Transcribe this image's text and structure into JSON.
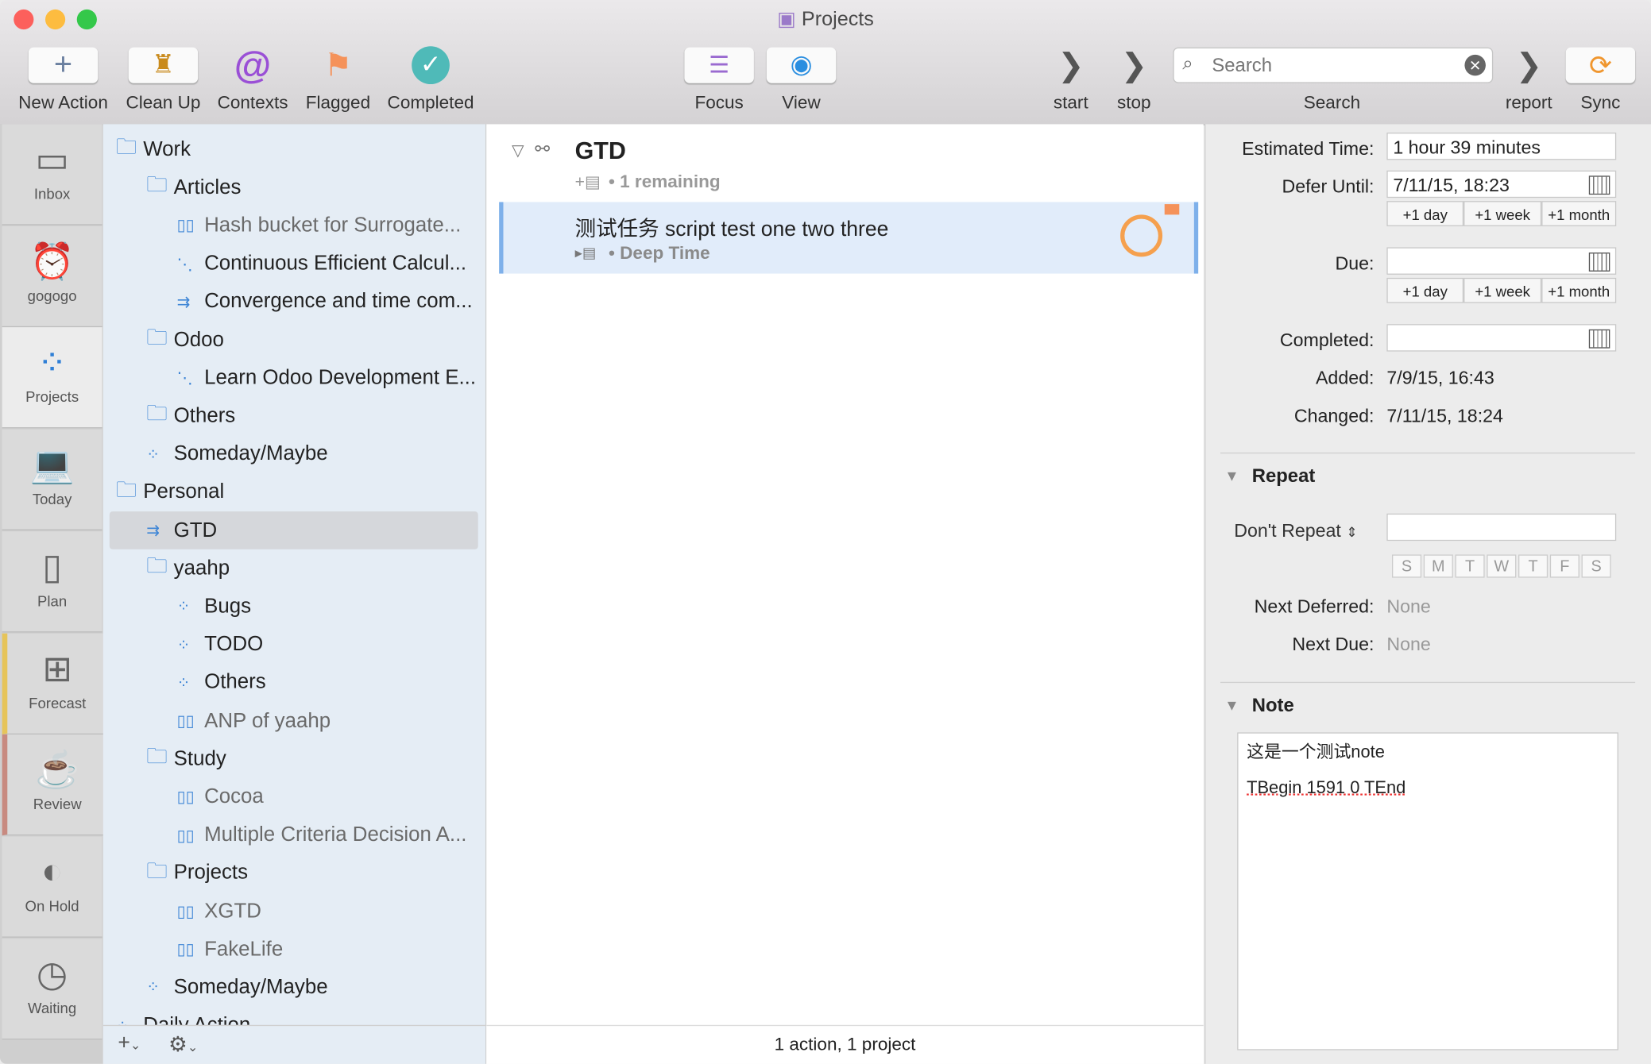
{
  "window": {
    "title": "Projects"
  },
  "toolbar": {
    "new_action": "New Action",
    "clean_up": "Clean Up",
    "contexts": "Contexts",
    "flagged": "Flagged",
    "completed": "Completed",
    "focus": "Focus",
    "view": "View",
    "start": "start",
    "stop": "stop",
    "search_label": "Search",
    "search_placeholder": "Search",
    "report": "report",
    "sync": "Sync"
  },
  "rail": [
    "Inbox",
    "gogogo",
    "Projects",
    "Today",
    "Plan",
    "Forecast",
    "Review",
    "On Hold",
    "Waiting"
  ],
  "sidebar": [
    {
      "label": "Work",
      "type": "folder"
    },
    {
      "label": "Articles",
      "type": "folder"
    },
    {
      "label": "Hash bucket for Surrogate...",
      "type": "single"
    },
    {
      "label": "Continuous Efficient Calcul...",
      "type": "sequential"
    },
    {
      "label": "Convergence and time com...",
      "type": "parallel"
    },
    {
      "label": "Odoo",
      "type": "folder"
    },
    {
      "label": "Learn Odoo Development E...",
      "type": "sequential"
    },
    {
      "label": "Others",
      "type": "folder"
    },
    {
      "label": "Someday/Maybe",
      "type": "someday"
    },
    {
      "label": "Personal",
      "type": "folder"
    },
    {
      "label": "GTD",
      "type": "parallel"
    },
    {
      "label": "yaahp",
      "type": "folder"
    },
    {
      "label": "Bugs",
      "type": "someday"
    },
    {
      "label": "TODO",
      "type": "someday"
    },
    {
      "label": "Others",
      "type": "someday"
    },
    {
      "label": "ANP of yaahp",
      "type": "single"
    },
    {
      "label": "Study",
      "type": "folder"
    },
    {
      "label": "Cocoa",
      "type": "single"
    },
    {
      "label": "Multiple Criteria Decision A...",
      "type": "single"
    },
    {
      "label": "Projects",
      "type": "folder"
    },
    {
      "label": "XGTD",
      "type": "single"
    },
    {
      "label": "FakeLife",
      "type": "single"
    },
    {
      "label": "Someday/Maybe",
      "type": "someday"
    },
    {
      "label": "Daily Action",
      "type": "someday"
    }
  ],
  "main": {
    "project": "GTD",
    "remaining": "• 1 remaining",
    "task": "测试任务 script test one two three",
    "task_context": "• Deep Time",
    "status": "1 action, 1 project"
  },
  "inspector": {
    "estimated_label": "Estimated Time:",
    "estimated": "1 hour 39 minutes",
    "defer_label": "Defer Until:",
    "defer": "7/11/15, 18:23",
    "due_label": "Due:",
    "due": "",
    "completed_label": "Completed:",
    "completed": "",
    "plus_day": "+1 day",
    "plus_week": "+1 week",
    "plus_month": "+1 month",
    "added_label": "Added:",
    "added": "7/9/15, 16:43",
    "changed_label": "Changed:",
    "changed": "7/11/15, 18:24",
    "repeat_header": "Repeat",
    "repeat_mode": "Don't Repeat",
    "days": [
      "S",
      "M",
      "T",
      "W",
      "T",
      "F",
      "S"
    ],
    "next_deferred_label": "Next Deferred:",
    "next_deferred": "None",
    "next_due_label": "Next Due:",
    "next_due": "None",
    "note_header": "Note",
    "note_line1": "这是一个测试note",
    "note_line2": "TBegin 1591 0 TEnd"
  }
}
